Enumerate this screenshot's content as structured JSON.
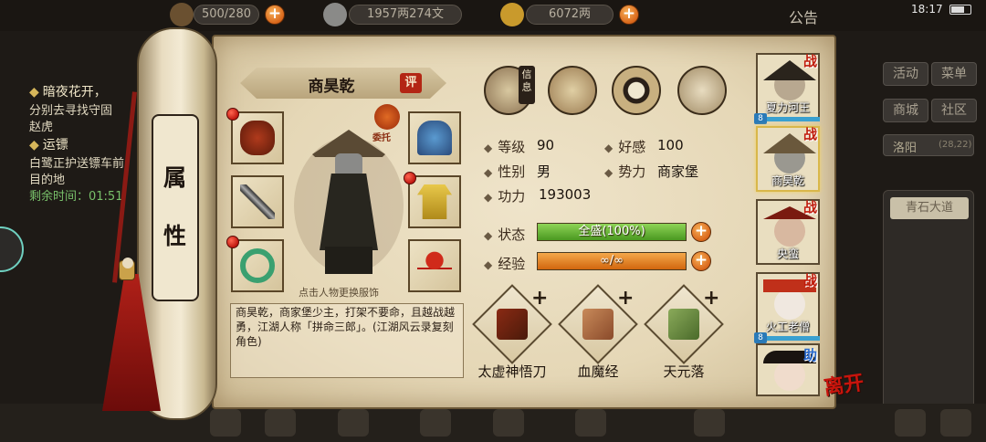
{
  "topbar": {
    "food": "500/280",
    "silver": "1957两274文",
    "gold": "6072两",
    "announcement": "公告",
    "time": "18:17"
  },
  "quests": {
    "q1_title": "暗夜花开，",
    "q1_desc": "分别去寻找守固",
    "q1_desc2": "赵虎",
    "q2_title": "运镖",
    "q2_desc": "白鹭正护送镖车前",
    "q2_desc2": "目的地",
    "remaining": "剩余时间：01:51"
  },
  "right_menu": {
    "activity": "活动",
    "menu": "菜单",
    "shop": "商城",
    "community": "社区",
    "location": "洛阳",
    "coords": "(28,22)",
    "road": "青石大道"
  },
  "scroll_tab": {
    "char1": "属",
    "char2": "性"
  },
  "character": {
    "name": "商昊乾",
    "eval": "评",
    "commission": "委托",
    "change_hint": "点击人物更换服饰",
    "bio": "商昊乾，商家堡少主，打架不要命，且越战越勇，江湖人称「拼命三郎」。(江湖风云录复刻角色)"
  },
  "top_icons": {
    "info": "信息"
  },
  "stats": {
    "level_label": "等级",
    "level": "90",
    "favor_label": "好感",
    "favor": "100",
    "gender_label": "性别",
    "gender": "男",
    "faction_label": "势力",
    "faction": "商家堡",
    "power_label": "功力",
    "power": "193003",
    "status_label": "状态",
    "status": "全盛(100%)",
    "status_fill": 1.0,
    "exp_label": "经验",
    "exp": "∞/∞",
    "exp_fill": 1.0
  },
  "skills": [
    {
      "name": "太虚神悟刀",
      "plus": "+"
    },
    {
      "name": "血魔经",
      "plus": "+"
    },
    {
      "name": "天元落",
      "plus": "+"
    }
  ],
  "roster": [
    {
      "name": "夏力河王",
      "badge": "战",
      "rank": "8"
    },
    {
      "name": "商昊乾",
      "badge": "战"
    },
    {
      "name": "央蛮",
      "badge": "战"
    },
    {
      "name": "火工老僧",
      "badge": "战",
      "rank": "8"
    },
    {
      "name": "",
      "badge": "助"
    }
  ],
  "leave": "离开",
  "colors": {
    "status_bar": "#6ab832",
    "exp_bar": "#e8821e",
    "badge_red": "#c01c0c"
  }
}
